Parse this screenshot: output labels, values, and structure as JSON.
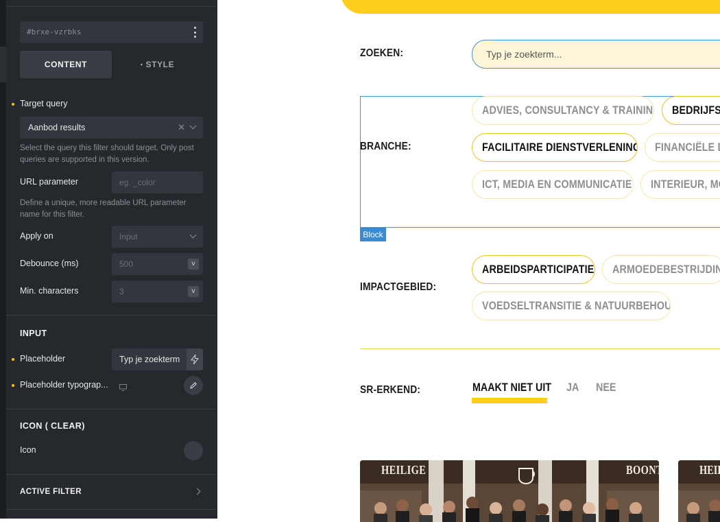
{
  "panel": {
    "element_id": "#brxe-vzrbks",
    "tabs": {
      "content": "CONTENT",
      "style": "STYLE",
      "style_bullet": "•"
    },
    "target_query": {
      "label": "Target query",
      "value": "Aanbod results",
      "help": "Select the query this filter should target. Only post queries are supported in this version."
    },
    "url_parameter": {
      "label": "URL parameter",
      "placeholder": "eg. _color",
      "help": "Define a unique, more readable URL parameter name for this filter."
    },
    "apply_on": {
      "label": "Apply on",
      "value": "Input"
    },
    "debounce": {
      "label": "Debounce (ms)",
      "placeholder": "500",
      "unit": "v"
    },
    "min_chars": {
      "label": "Min. characters",
      "placeholder": "3",
      "unit": "v"
    },
    "input_section": {
      "title": "INPUT",
      "placeholder_label": "Placeholder",
      "placeholder_value": "Typ je zoekterm",
      "typography_label": "Placeholder typograp..."
    },
    "icon_section": {
      "title": "ICON ( CLEAR)",
      "icon_label": "Icon"
    },
    "active_filter": {
      "title": "ACTIVE FILTER"
    }
  },
  "canvas": {
    "search": {
      "label": "ZOEKEN:",
      "placeholder": "Typ je zoekterm..."
    },
    "branche": {
      "label": "BRANCHE:",
      "pills": [
        {
          "label": "ADVIES, CONSULTANCY & TRAINING",
          "selected": false
        },
        {
          "label": "BEDRIJFSU",
          "selected": true
        },
        {
          "label": "FACILITAIRE DIENSTVERLENING",
          "selected": true
        },
        {
          "label": "FINANCIËLE DI",
          "selected": false
        },
        {
          "label": "ICT, MEDIA EN COMMUNICATIE",
          "selected": false
        },
        {
          "label": "INTERIEUR, MO",
          "selected": false
        }
      ],
      "block_tag": "Block"
    },
    "impact": {
      "label": "IMPACTGEBIED:",
      "pills": [
        {
          "label": "ARBEIDSPARTICIPATIE",
          "selected": true
        },
        {
          "label": "ARMOEDEBESTRIJDING",
          "selected": false
        },
        {
          "label": "VOEDSELTRANSITIE & NATUURBEHOUD",
          "selected": false
        }
      ]
    },
    "sr": {
      "label": "SR-ERKEND:",
      "options": [
        "MAAKT NIET UIT",
        "JA",
        "NEE"
      ],
      "selected": "MAAKT NIET UIT"
    },
    "cards": [
      {
        "sign_left": "HEILIGE",
        "sign_right": "BOONT"
      },
      {
        "sign_left": "HEIL"
      }
    ],
    "colors": {
      "accent": "#ffcd1c",
      "selection": "#4a90c9",
      "panel": "#25282d"
    }
  }
}
